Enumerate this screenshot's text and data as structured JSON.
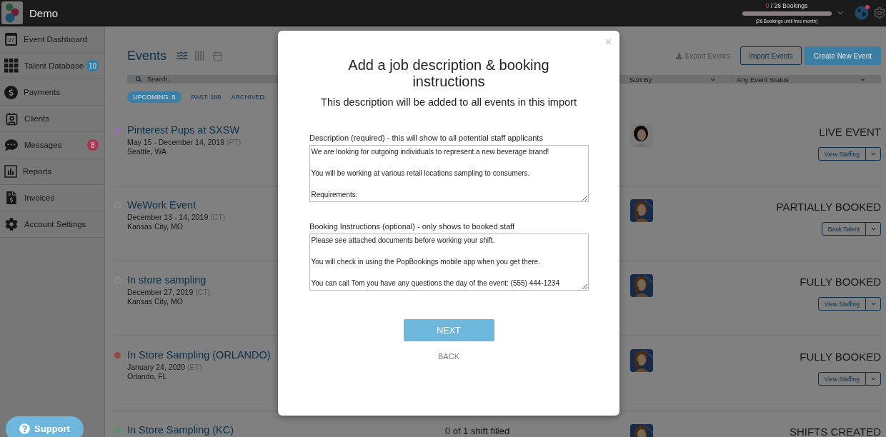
{
  "app": {
    "name": "Demo"
  },
  "bookings": {
    "count": "0",
    "total": "/ 26 Bookings",
    "level": 0,
    "note": "(26 Bookings until free month)",
    "notification": true
  },
  "sidebar": {
    "items": [
      {
        "kind": "calendar",
        "label": "Event Dashboard",
        "icon_label": "27"
      },
      {
        "kind": "grid",
        "label": "Talent Database",
        "badge": "10",
        "color": "#2f7eaa"
      },
      {
        "kind": "payments",
        "label": "Payments"
      },
      {
        "kind": "clients",
        "label": "Clients"
      },
      {
        "kind": "messages",
        "label": "Messages",
        "badge": "8",
        "color": "#a8364f"
      },
      {
        "kind": "reports",
        "label": "Reports"
      },
      {
        "kind": "invoices",
        "label": "Invoices"
      },
      {
        "kind": "settings",
        "label": "Account Settings"
      }
    ]
  },
  "support": {
    "label": "Support"
  },
  "events": {
    "title": "Events",
    "views": [
      {
        "kind": "list",
        "selected": true
      },
      {
        "kind": "columns",
        "selected": false
      },
      {
        "kind": "calendar",
        "selected": false
      }
    ],
    "export": "Export Events",
    "import": "Import Events",
    "create": "Create New Event",
    "search": {
      "placeholder": "Search.."
    },
    "sort": {
      "value": "Sort By"
    },
    "status_filter": {
      "value": "Any Event Status"
    },
    "tabs": [
      {
        "label": "UPCOMING: 5",
        "selected": true
      },
      {
        "label": "PAST: 189",
        "selected": false
      },
      {
        "label": "ARCHIVED:",
        "selected": false
      }
    ],
    "rows": [
      {
        "title": "Pinterest Pups at SXSW",
        "dates": "May 15 - December 14, 2019",
        "tz": "(PT)",
        "location": "Seattle, WA",
        "filled": true,
        "color": "#9274a8",
        "status": "LIVE EVENT",
        "action": "View Staffing"
      },
      {
        "title": "WeWork Event",
        "dates": "December 13 - 14, 2019",
        "tz": "(CT)",
        "location": "Kansas City, MO",
        "filled": false,
        "color": "#999999",
        "status": "PARTIALLY BOOKED",
        "action": "Book Talent"
      },
      {
        "title": "In store sampling",
        "dates": "December 27, 2019",
        "tz": "(CT)",
        "location": "Kansas City, MO",
        "filled": false,
        "color": "#999999",
        "status": "FULLY BOOKED",
        "action": "View Staffing"
      },
      {
        "title": "In Store Sampling (ORLANDO)",
        "dates": "January 24, 2020",
        "tz": "(ET)",
        "location": "Orlando, FL",
        "filled": true,
        "color": "#914a42",
        "status": "FULLY BOOKED",
        "action": "View Staffing"
      },
      {
        "title": "In Store Sampling (KC)",
        "filled": true,
        "color": "#5f8f6c",
        "shifts": "0 of 1 shift filled",
        "status": "SHIFTS CREATED"
      }
    ]
  },
  "modal": {
    "title": "Add a job description & booking instructions",
    "subtitle": "This description will be added to all events in this import",
    "description": {
      "label": "Description (required) - this will show to all potential staff applicants",
      "value": "We are looking for outgoing individuals to represent a new beverage brand!\n\nYou will be working at various retail locations sampling to consumers.\n\nRequirements:"
    },
    "instructions": {
      "label": "Booking Instructions (optional) - only shows to booked staff",
      "value": "Please see attached documents before working your shift.\n\nYou will check in using the PopBookings mobile app when you get there.\n\nYou can call Tom you have any questions the day of the event: (555) 444-1234"
    },
    "next": "NEXT",
    "back": "BACK"
  }
}
